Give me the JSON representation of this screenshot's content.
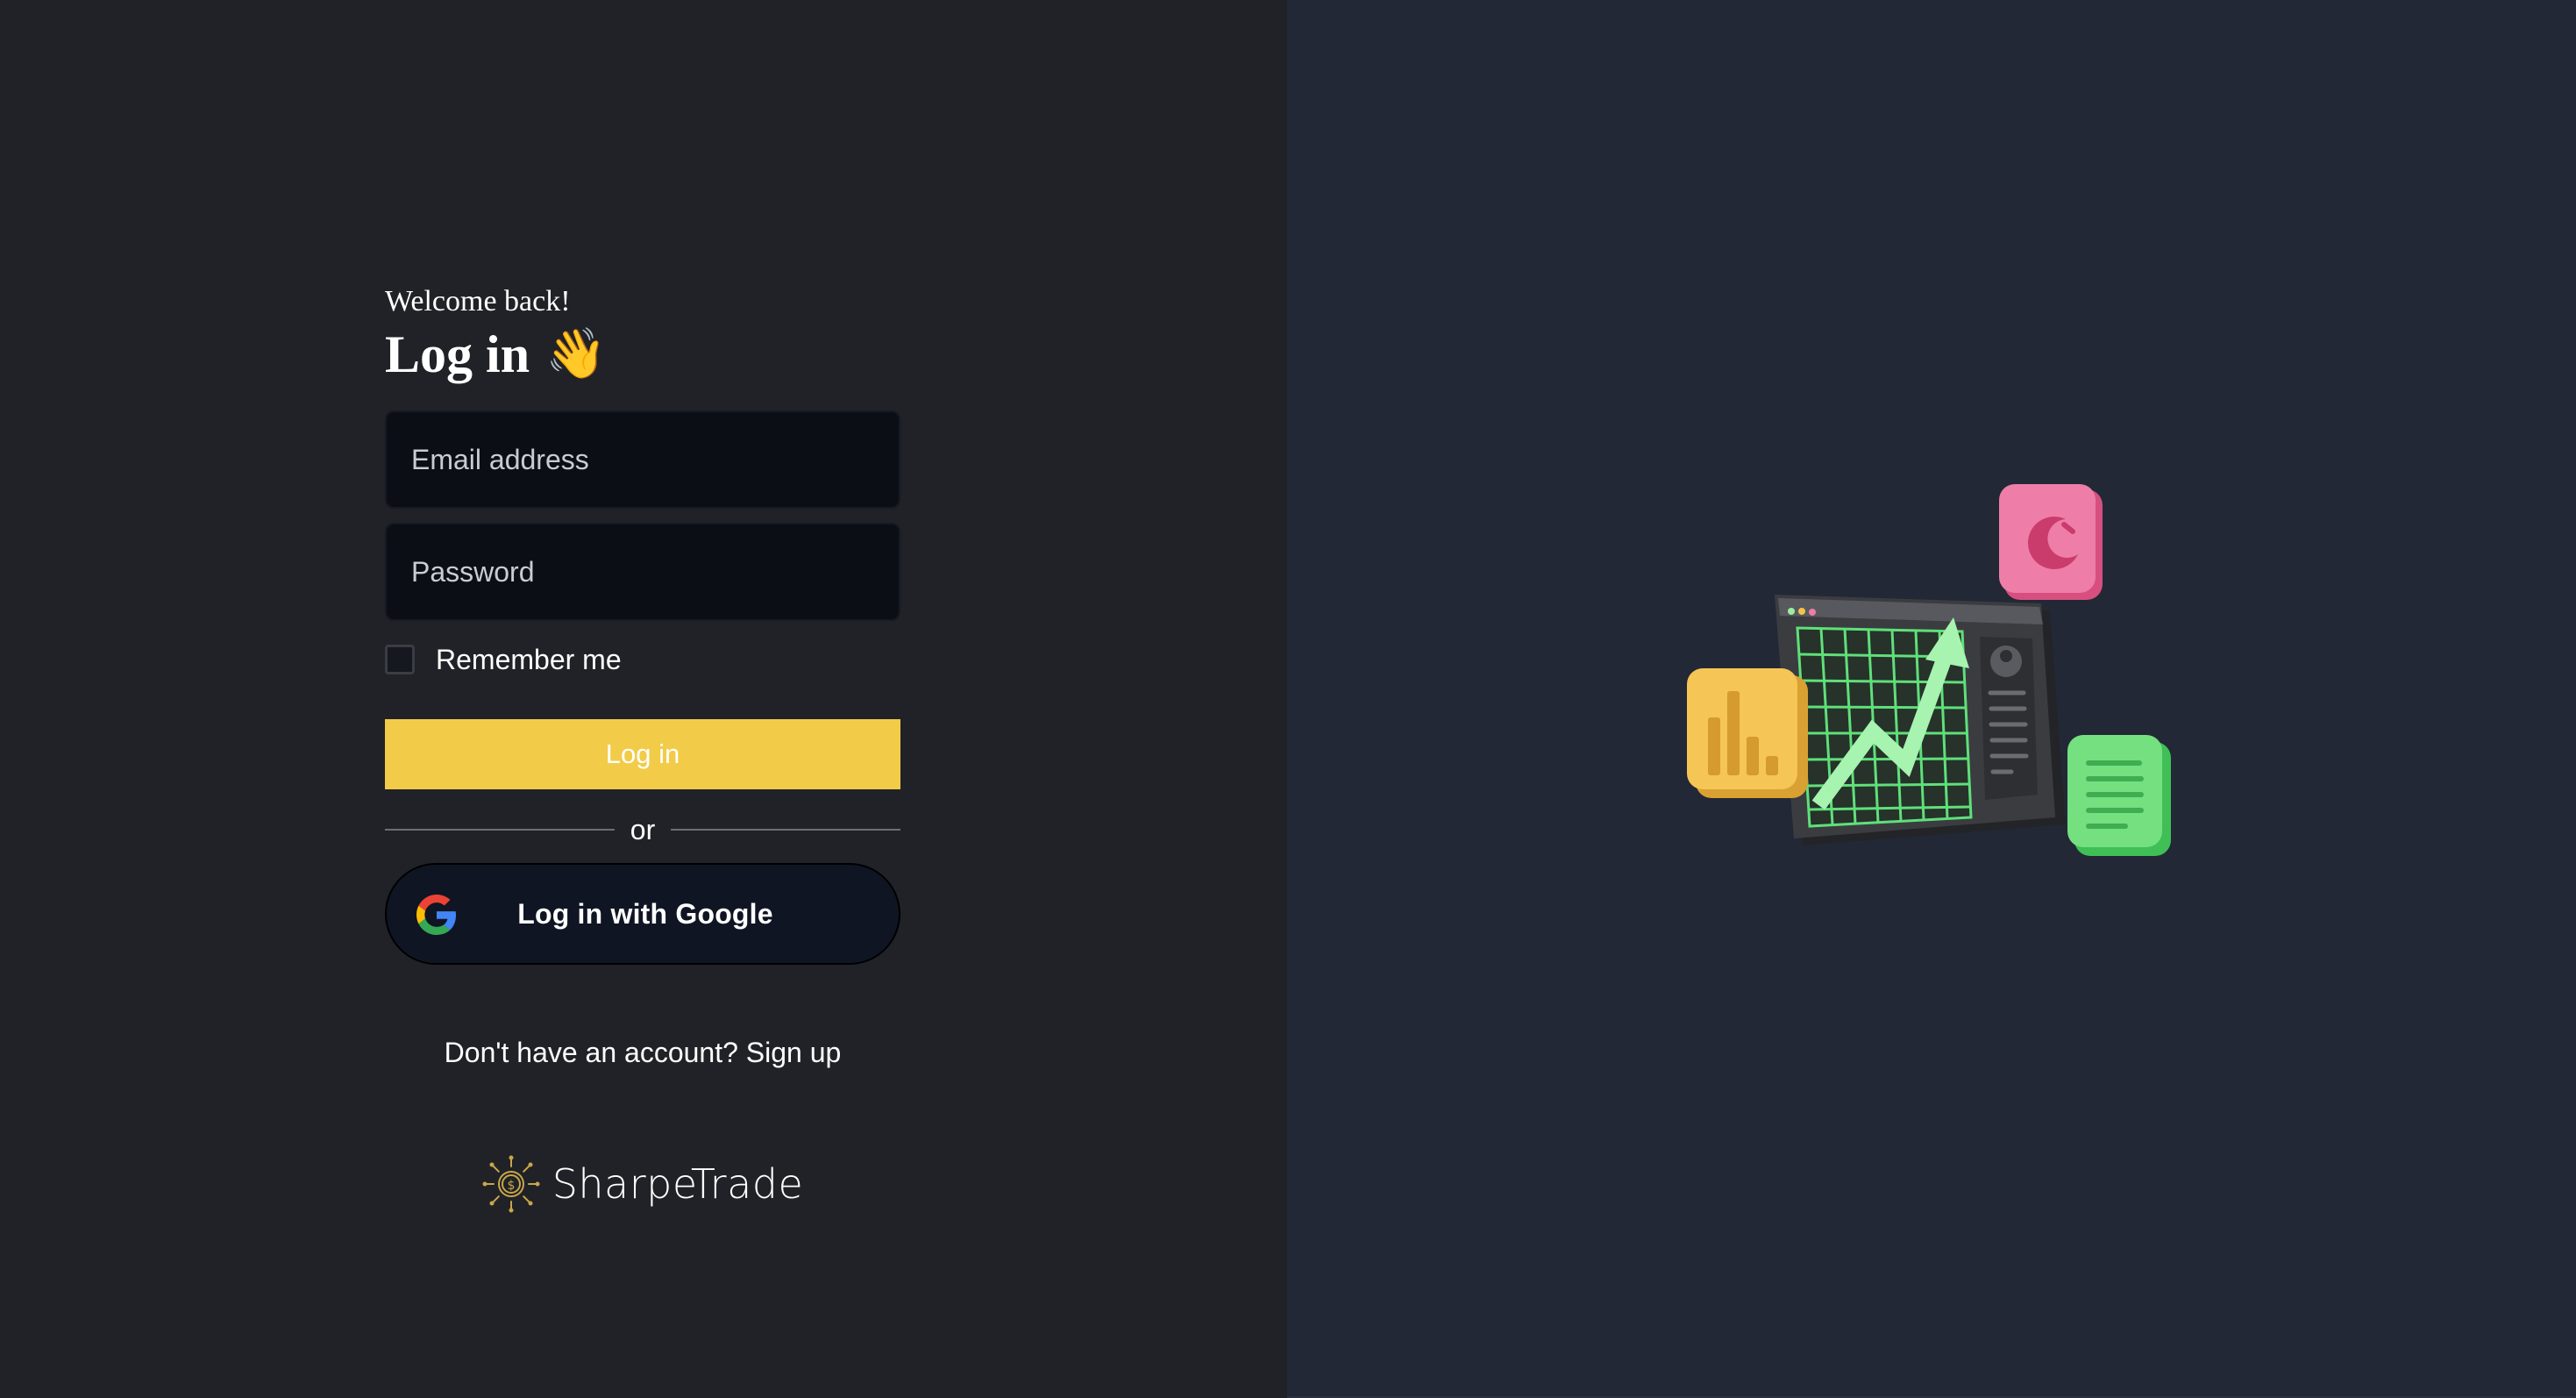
{
  "login": {
    "welcome_text": "Welcome back!",
    "title": "Log in",
    "title_emoji": "👋",
    "email_placeholder": "Email address",
    "password_placeholder": "Password",
    "remember_label": "Remember me",
    "login_button_label": "Log in",
    "divider_text": "or",
    "google_button_label": "Log in with Google",
    "signup_prompt": "Don't have an account? ",
    "signup_link": "Sign up"
  },
  "brand": {
    "name": "SharpeTrade"
  },
  "colors": {
    "left_background": "#202227",
    "right_background": "#222835",
    "field_background": "#0b0e15",
    "primary_button": "#f2cb48",
    "google_button_background": "#0f1523"
  },
  "icons": {
    "google": "google-g-icon",
    "brand_logo": "sharpetrade-logo-icon",
    "hand": "waving-hand-emoji"
  }
}
